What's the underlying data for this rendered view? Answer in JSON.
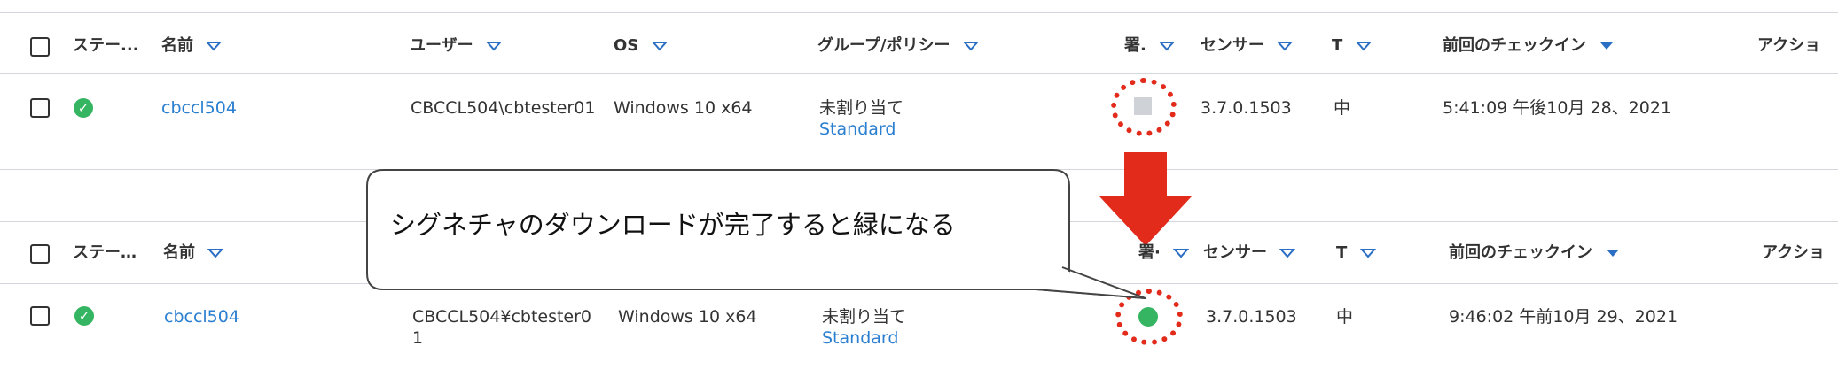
{
  "table_before": {
    "headers": {
      "status": "ステー...",
      "name": "名前",
      "user": "ユーザー",
      "os": "OS",
      "group": "グループ/ポリシー",
      "sig": "署.",
      "sensor": "センサー",
      "t": "T",
      "last_checkin": "前回のチェックイン",
      "action": "アクショ"
    },
    "row": {
      "name": "cbccl504",
      "user": "CBCCL504\\cbtester01",
      "os": "Windows 10 x64",
      "group_line1": "未割り当て",
      "group_line2": "Standard",
      "sensor": "3.7.0.1503",
      "t": "中",
      "last_checkin": "5:41:09 午後10月 28、2021",
      "sig_status": "gray"
    }
  },
  "table_after": {
    "headers": {
      "status": "ステー…",
      "name": "名前",
      "sig": "署·",
      "sensor": "センサー",
      "t": "T",
      "last_checkin": "前回のチェックイン",
      "action": "アクショ"
    },
    "row": {
      "name": "cbccl504",
      "user_line1": "CBCCL504¥cbtester0",
      "user_line2": "1",
      "os": "Windows 10 x64",
      "group_line1": "未割り当て",
      "group_line2": "Standard",
      "sensor": "3.7.0.1503",
      "t": "中",
      "last_checkin": "9:46:02 午前10月 29、2021",
      "sig_status": "green"
    }
  },
  "callout": {
    "text": "シグネチャのダウンロードが完了すると緑になる"
  },
  "colors": {
    "link": "#2b7fd0",
    "status_green": "#35b561",
    "annotation_red": "#e32b1c",
    "sort_triangle": "#2b6fc4"
  },
  "icons": {
    "status": "check-circle-icon",
    "filter": "filter-triangle-icon",
    "sort": "sort-desc-icon",
    "arrow": "down-arrow-icon"
  }
}
